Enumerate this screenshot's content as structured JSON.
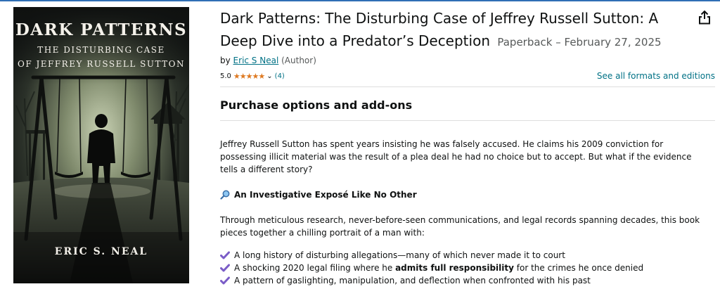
{
  "cover": {
    "title": "DARK PATTERNS",
    "subtitle_line1": "THE DISTURBING CASE",
    "subtitle_line2": "OF JEFFREY RUSSELL SUTTON",
    "author": "ERIC S. NEAL"
  },
  "product": {
    "title": "Dark Patterns: The Disturbing Case of Jeffrey Russell Sutton: A Deep Dive into a Predator’s Deception",
    "edition": "Paperback – February 27, 2025",
    "by_prefix": "by",
    "author_name": "Eric S Neal",
    "author_role": "(Author)",
    "rating_value": "5.0",
    "rating_stars": 5,
    "rating_count": "(4)",
    "see_all_label": "See all formats and editions",
    "share_icon": "share-icon"
  },
  "purchase": {
    "heading": "Purchase options and add-ons"
  },
  "description": {
    "paragraph1": "Jeffrey Russell Sutton has spent years insisting he was falsely accused. He claims his 2009 conviction for possessing illicit material was the result of a plea deal he had no choice but to accept. But what if the evidence tells a different story?",
    "subheading": "An Investigative Exposé Like No Other",
    "paragraph2": "Through meticulous research, never-before-seen communications, and legal records spanning decades, this book pieces together a chilling portrait of a man with:",
    "bullet1": "A long history of disturbing allegations—many of which never made it to court",
    "bullet2_pre": "A shocking 2020 legal filing where he ",
    "bullet2_bold": "admits full responsibility",
    "bullet2_post": " for the crimes he once denied",
    "bullet3": "A pattern of gaslighting, manipulation, and deflection when confronted with his past"
  },
  "colors": {
    "link": "#007185",
    "star": "#de7921",
    "check": "#7a5cc7",
    "accent_bar": "#2f6fb5"
  }
}
